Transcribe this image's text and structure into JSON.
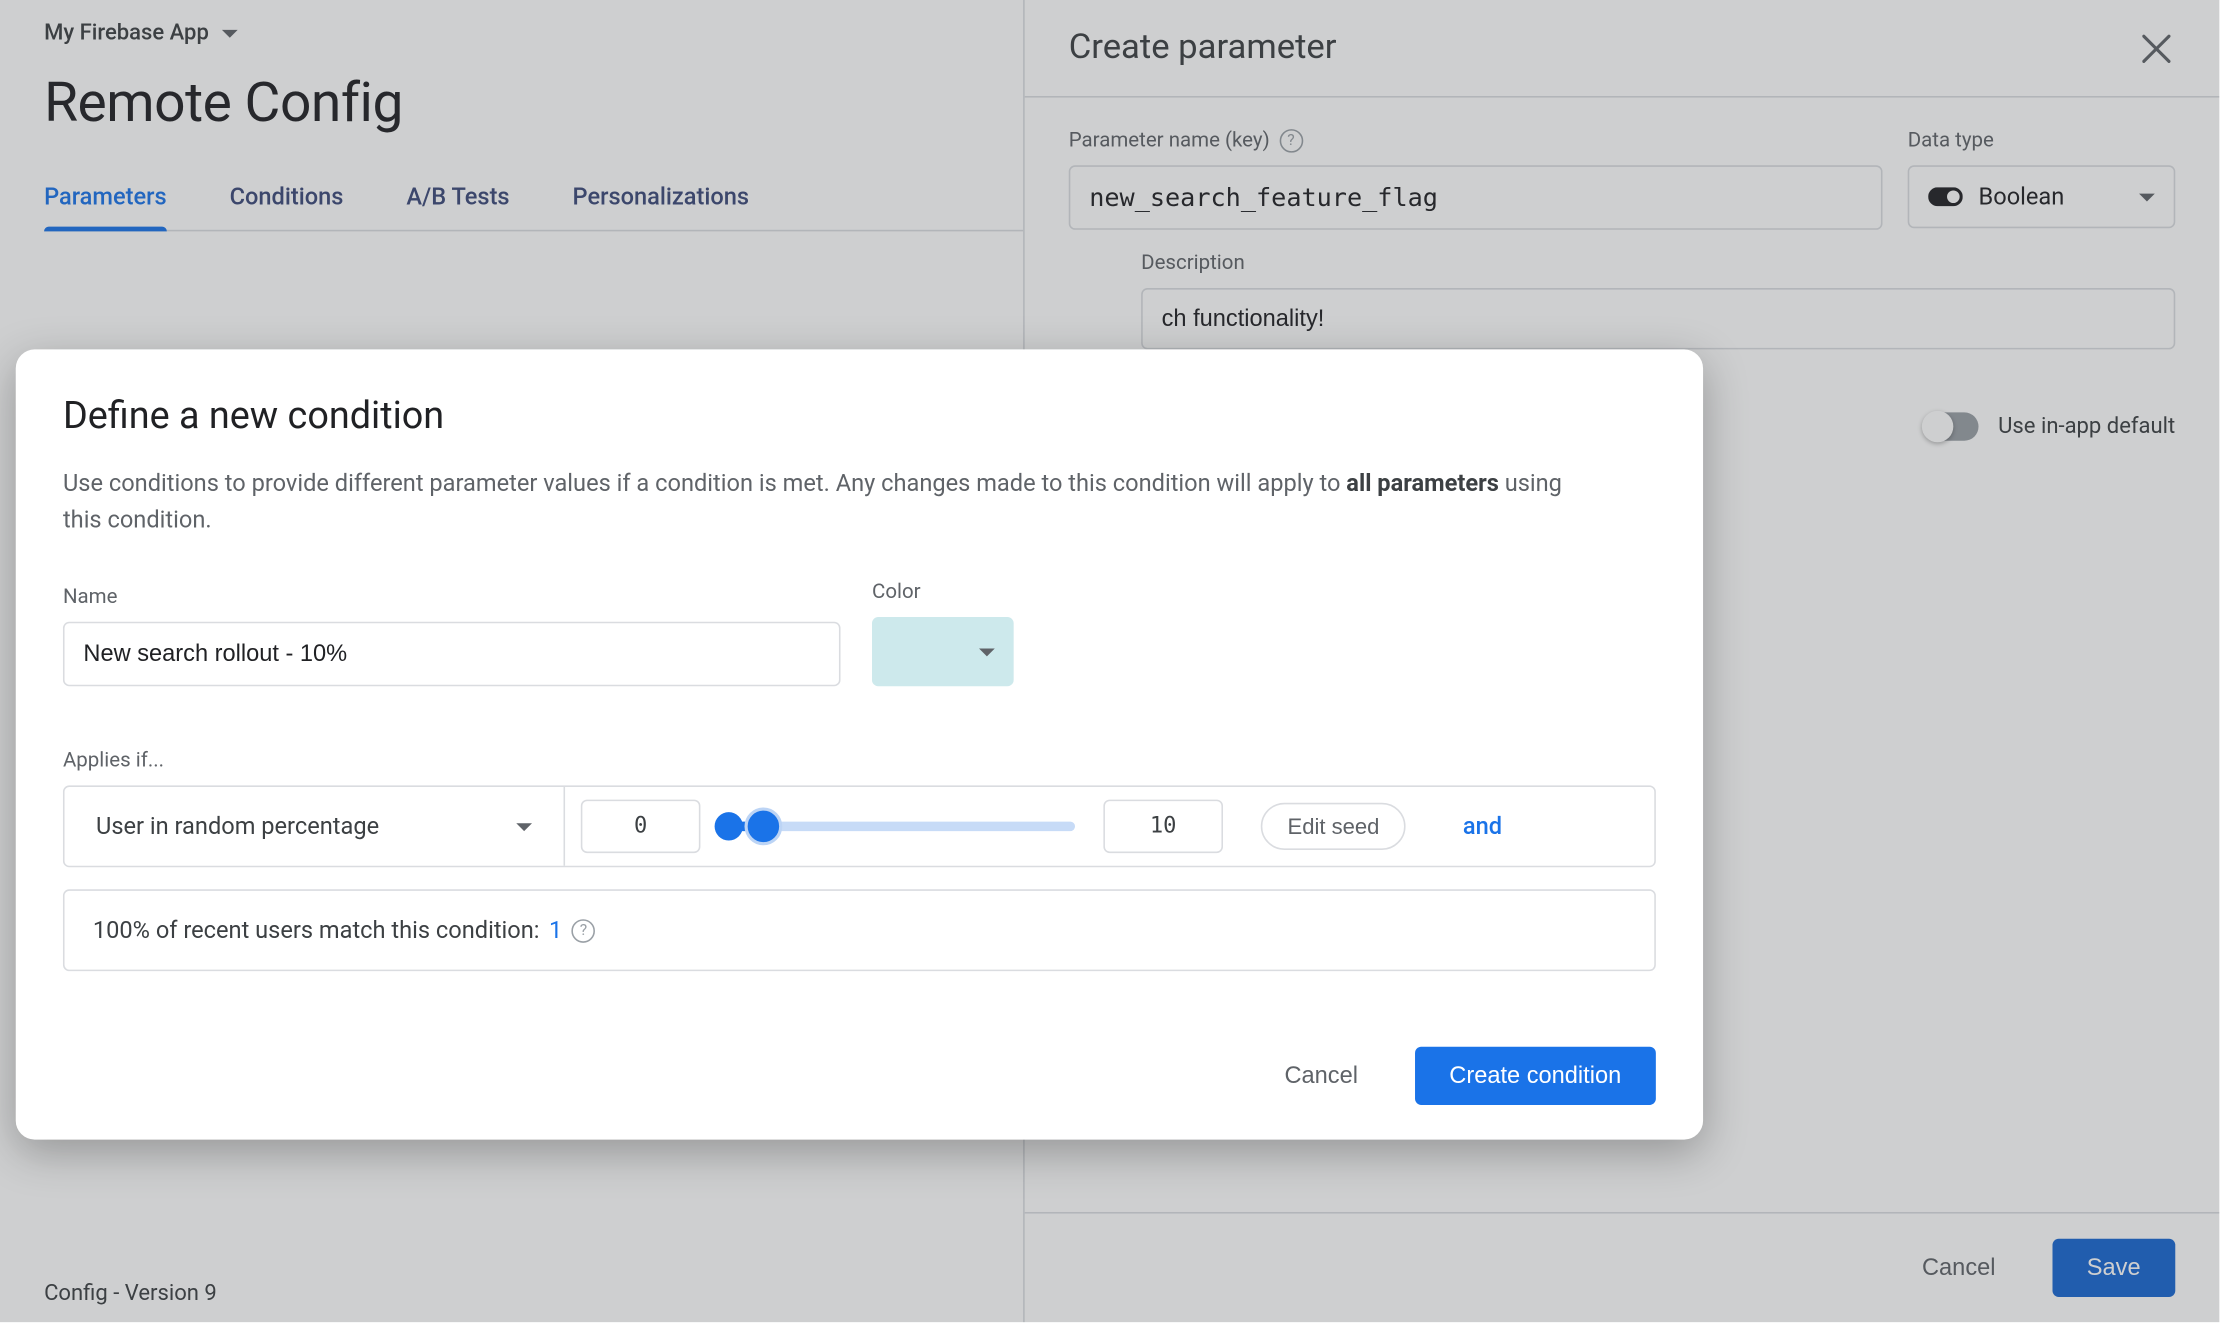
{
  "header": {
    "project_name": "My Firebase App",
    "page_title": "Remote Config"
  },
  "tabs": [
    {
      "label": "Parameters",
      "active": true
    },
    {
      "label": "Conditions",
      "active": false
    },
    {
      "label": "A/B Tests",
      "active": false
    },
    {
      "label": "Personalizations",
      "active": false
    }
  ],
  "right_panel": {
    "title": "Create parameter",
    "param_name_label": "Parameter name (key)",
    "param_name_value": "new_search_feature_flag",
    "data_type_label": "Data type",
    "data_type_value": "Boolean",
    "description_label": "Description",
    "description_value": "ch functionality!",
    "in_app_default_label": "Use in-app default",
    "cancel_label": "Cancel",
    "save_label": "Save"
  },
  "modal": {
    "title": "Define a new condition",
    "subtitle_prefix": "Use conditions to provide different parameter values if a condition is met. Any changes made to this condition will apply to ",
    "subtitle_bold": "all parameters",
    "subtitle_suffix": " using this condition.",
    "name_label": "Name",
    "name_value": "New search rollout - 10%",
    "color_label": "Color",
    "color_value": "#cde9ec",
    "applies_label": "Applies if...",
    "condition_type": "User in random percentage",
    "range_from": "0",
    "range_to": "10",
    "edit_seed_label": "Edit seed",
    "and_label": "and",
    "match_text_prefix": "100% of recent users match this condition: ",
    "match_count": "1",
    "cancel_label": "Cancel",
    "create_label": "Create condition"
  },
  "footer": {
    "version_text": "Config - Version 9"
  }
}
